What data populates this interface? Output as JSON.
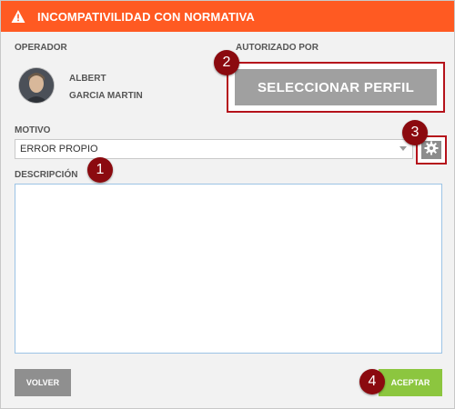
{
  "dialog": {
    "title": "INCOMPATIVILIDAD CON NORMATIVA",
    "title_bg": "#ff5a22"
  },
  "operator": {
    "label": "OPERADOR",
    "first_name": "ALBERT",
    "last_name": "GARCIA MARTIN"
  },
  "authorized": {
    "label": "AUTORIZADO POR",
    "select_profile_button": "SELECCIONAR PERFIL"
  },
  "motivo": {
    "label": "MOTIVO",
    "selected_value": "ERROR PROPIO",
    "settings_icon": "gear-icon"
  },
  "description": {
    "label": "DESCRIPCIÓN",
    "value": ""
  },
  "footer": {
    "back_button": "VOLVER",
    "accept_button": "ACEPTAR",
    "accept_color": "#8cc63f"
  },
  "markers": [
    "1",
    "2",
    "3",
    "4"
  ],
  "colors": {
    "marker": "#8b0a0f",
    "highlight_border": "#b5121b"
  }
}
